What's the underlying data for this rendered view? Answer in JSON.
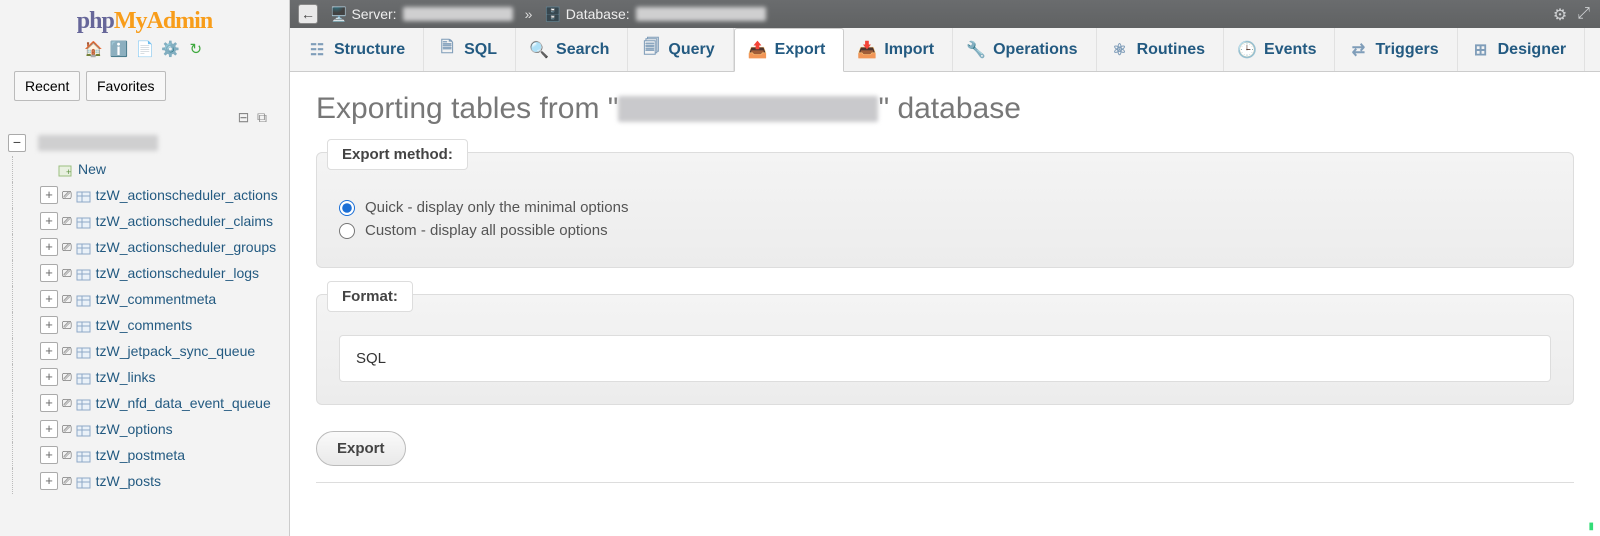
{
  "logo": {
    "left": "php",
    "right": "MyAdmin"
  },
  "sidebar_tabs": {
    "recent": "Recent",
    "favorites": "Favorites"
  },
  "tree": {
    "db_name_redacted": true,
    "new_label": "New",
    "tables": [
      "tzW_actionscheduler_actions",
      "tzW_actionscheduler_claims",
      "tzW_actionscheduler_groups",
      "tzW_actionscheduler_logs",
      "tzW_commentmeta",
      "tzW_comments",
      "tzW_jetpack_sync_queue",
      "tzW_links",
      "tzW_nfd_data_event_queue",
      "tzW_options",
      "tzW_postmeta",
      "tzW_posts"
    ]
  },
  "breadcrumb": {
    "server_label": "Server:",
    "database_label": "Database:"
  },
  "tabs": {
    "structure": "Structure",
    "sql": "SQL",
    "search": "Search",
    "query": "Query",
    "export": "Export",
    "import": "Import",
    "operations": "Operations",
    "routines": "Routines",
    "events": "Events",
    "triggers": "Triggers",
    "designer": "Designer"
  },
  "heading": {
    "before": "Exporting tables from \"",
    "after": "\" database"
  },
  "export_method": {
    "legend": "Export method:",
    "quick": "Quick - display only the minimal options",
    "custom": "Custom - display all possible options"
  },
  "format": {
    "legend": "Format:",
    "value": "SQL"
  },
  "buttons": {
    "export": "Export"
  }
}
